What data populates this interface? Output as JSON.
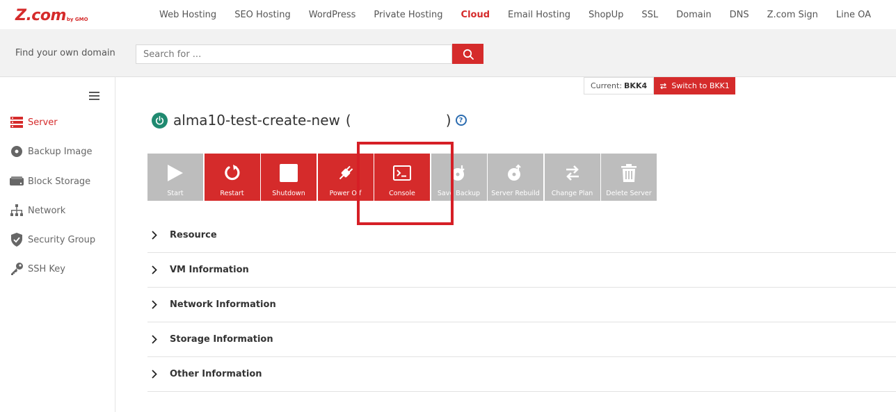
{
  "logo": {
    "main": "Z.com",
    "sub": "by GMO"
  },
  "nav": {
    "items": [
      "Web Hosting",
      "SEO Hosting",
      "WordPress",
      "Private Hosting",
      "Cloud",
      "Email Hosting",
      "ShopUp",
      "SSL",
      "Domain",
      "DNS",
      "Z.com Sign",
      "Line OA"
    ],
    "active": "Cloud"
  },
  "domain_search": {
    "label": "Find your own domain",
    "placeholder": "Search for ..."
  },
  "sidebar": {
    "items": [
      {
        "label": "Server",
        "icon": "server-icon",
        "active": true
      },
      {
        "label": "Backup Image",
        "icon": "disc-icon",
        "active": false
      },
      {
        "label": "Block Storage",
        "icon": "storage-icon",
        "active": false
      },
      {
        "label": "Network",
        "icon": "network-icon",
        "active": false
      },
      {
        "label": "Security Group",
        "icon": "shield-icon",
        "active": false
      },
      {
        "label": "SSH Key",
        "icon": "key-icon",
        "active": false
      }
    ]
  },
  "region": {
    "current_label": "Current:",
    "current_value": "BKK4",
    "switch_label": "Switch to BKK1"
  },
  "server": {
    "name": "alma10-test-create-new",
    "open_paren": "(",
    "close_paren": ")",
    "help": "?"
  },
  "actions": [
    {
      "label": "Start",
      "icon": "play-icon",
      "enabled": false
    },
    {
      "label": "Restart",
      "icon": "restart-icon",
      "enabled": true
    },
    {
      "label": "Shutdown",
      "icon": "stop-icon",
      "enabled": true
    },
    {
      "label": "Power Off",
      "icon": "plug-icon",
      "enabled": true
    },
    {
      "label": "Console",
      "icon": "terminal-icon",
      "enabled": true
    },
    {
      "label": "Save Backup",
      "icon": "backup-icon",
      "enabled": false
    },
    {
      "label": "Server Rebuild",
      "icon": "rebuild-icon",
      "enabled": false
    },
    {
      "label": "Change Plan",
      "icon": "swap-icon",
      "enabled": false
    },
    {
      "label": "Delete Server",
      "icon": "trash-icon",
      "enabled": false
    }
  ],
  "sections": [
    "Resource",
    "VM Information",
    "Network Information",
    "Storage Information",
    "Other Information"
  ],
  "colors": {
    "brand": "#d52b2b",
    "disabled": "#bdbdbd",
    "status_on": "#1f8a70",
    "highlight": "#d61f26"
  }
}
